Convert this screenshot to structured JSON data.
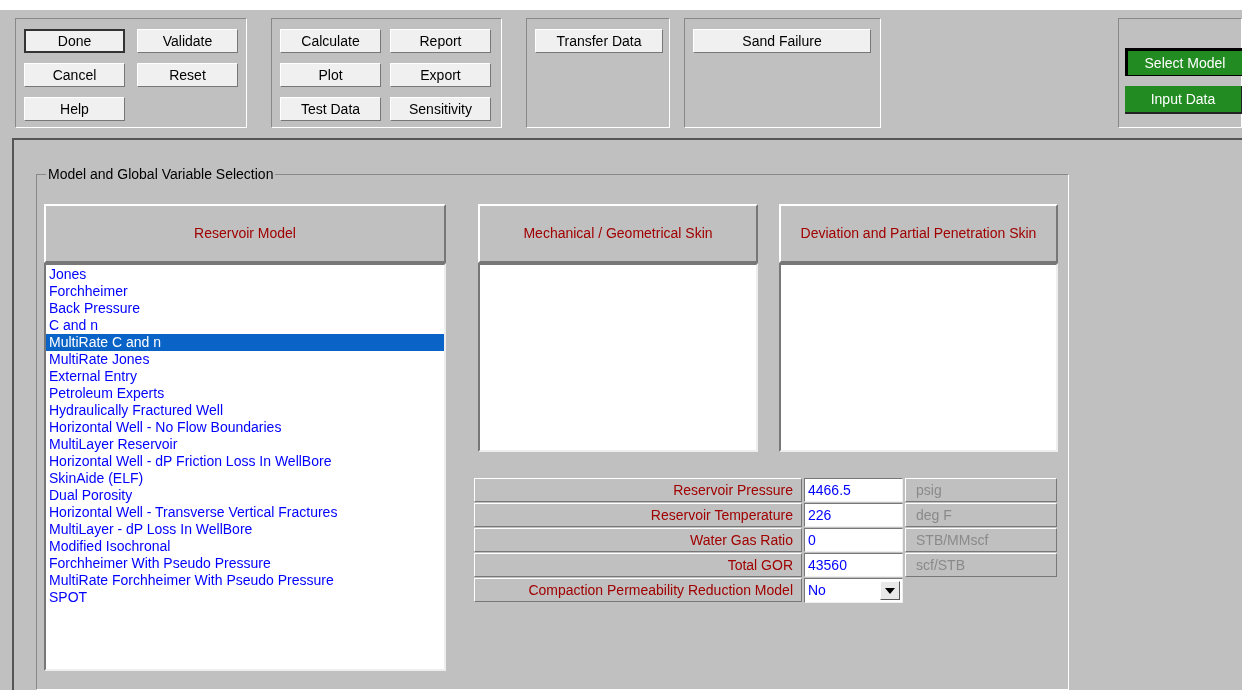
{
  "toolbar_groups": [
    {
      "buttons": [
        {
          "label": "Done",
          "default": true
        },
        {
          "label": "Validate",
          "default": false
        },
        {
          "label": "Cancel",
          "default": false
        },
        {
          "label": "Reset",
          "default": false
        },
        {
          "label": "Help",
          "default": false
        }
      ]
    },
    {
      "buttons": [
        {
          "label": "Calculate",
          "default": false
        },
        {
          "label": "Report",
          "default": false
        },
        {
          "label": "Plot",
          "default": false
        },
        {
          "label": "Export",
          "default": false
        },
        {
          "label": "Test Data",
          "default": false
        },
        {
          "label": "Sensitivity",
          "default": false
        }
      ]
    },
    {
      "buttons": [
        {
          "label": "Transfer Data",
          "default": false
        }
      ]
    },
    {
      "buttons": [
        {
          "label": "Sand Failure",
          "default": false
        }
      ]
    }
  ],
  "navigation": [
    {
      "label": "Select Model",
      "selected": true
    },
    {
      "label": "Input Data",
      "selected": false
    }
  ],
  "group_title": "Model and Global Variable Selection",
  "reservoir_model": {
    "header": "Reservoir Model",
    "items": [
      {
        "label": "Jones",
        "selected": false
      },
      {
        "label": "Forchheimer",
        "selected": false
      },
      {
        "label": "Back Pressure",
        "selected": false
      },
      {
        "label": "C and n",
        "selected": false
      },
      {
        "label": "MultiRate C and n",
        "selected": true
      },
      {
        "label": "MultiRate Jones",
        "selected": false
      },
      {
        "label": "External Entry",
        "selected": false
      },
      {
        "label": "Petroleum Experts",
        "selected": false
      },
      {
        "label": "Hydraulically Fractured Well",
        "selected": false
      },
      {
        "label": "Horizontal Well - No Flow Boundaries",
        "selected": false
      },
      {
        "label": "MultiLayer Reservoir",
        "selected": false
      },
      {
        "label": "Horizontal Well - dP Friction Loss In WellBore",
        "selected": false
      },
      {
        "label": "SkinAide (ELF)",
        "selected": false
      },
      {
        "label": "Dual Porosity",
        "selected": false
      },
      {
        "label": "Horizontal Well - Transverse Vertical Fractures",
        "selected": false
      },
      {
        "label": "MultiLayer - dP Loss In WellBore",
        "selected": false
      },
      {
        "label": "Modified Isochronal",
        "selected": false
      },
      {
        "label": "Forchheimer With Pseudo Pressure",
        "selected": false
      },
      {
        "label": "MultiRate Forchheimer With Pseudo Pressure",
        "selected": false
      },
      {
        "label": "SPOT",
        "selected": false
      }
    ]
  },
  "mechanical_skin": {
    "header": "Mechanical / Geometrical Skin"
  },
  "deviation_skin": {
    "header": "Deviation and Partial Penetration Skin"
  },
  "variables": [
    {
      "kind": "input",
      "label": "Reservoir Pressure",
      "value": "4466.5",
      "unit": "psig"
    },
    {
      "kind": "input",
      "label": "Reservoir Temperature",
      "value": "226",
      "unit": "deg F"
    },
    {
      "kind": "input",
      "label": "Water Gas Ratio",
      "value": "0",
      "unit": "STB/MMscf"
    },
    {
      "kind": "input",
      "label": "Total GOR",
      "value": "43560",
      "unit": "scf/STB"
    },
    {
      "kind": "dropdown",
      "label": "Compaction Permeability Reduction Model",
      "value": "No"
    }
  ]
}
